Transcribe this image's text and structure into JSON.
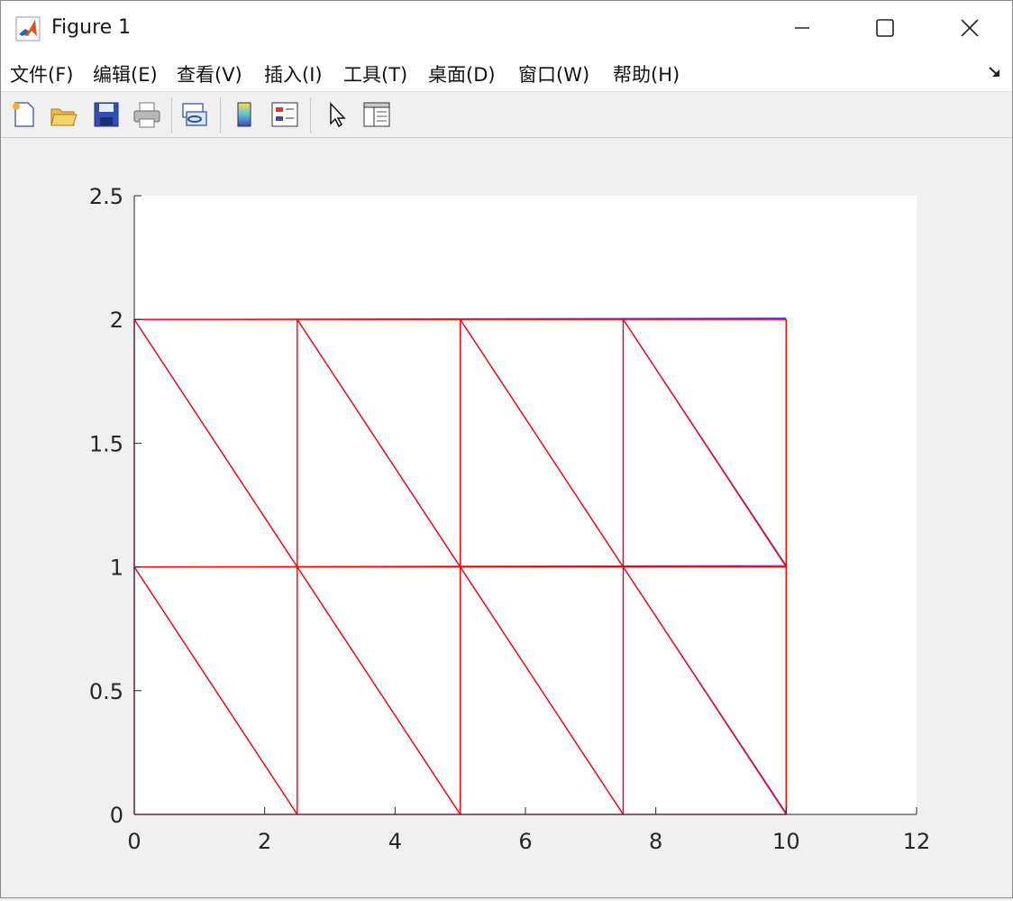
{
  "window": {
    "title": "Figure 1",
    "icon": "matlab-logo-icon",
    "controls": [
      "minimize-icon",
      "maximize-icon",
      "close-icon"
    ]
  },
  "menubar": {
    "items": [
      {
        "label": "文件(F)"
      },
      {
        "label": "编辑(E)"
      },
      {
        "label": "查看(V)"
      },
      {
        "label": "插入(I)"
      },
      {
        "label": "工具(T)"
      },
      {
        "label": "桌面(D)"
      },
      {
        "label": "窗口(W)"
      },
      {
        "label": "帮助(H)"
      }
    ],
    "dock_icon": "dock-arrow-icon"
  },
  "toolbar": {
    "buttons": [
      {
        "icon": "new-figure-icon"
      },
      {
        "icon": "open-folder-icon"
      },
      {
        "icon": "save-icon"
      },
      {
        "icon": "print-icon"
      },
      {
        "icon": "link-plot-icon"
      },
      {
        "icon": "colorbar-icon"
      },
      {
        "icon": "legend-icon"
      },
      {
        "icon": "pointer-icon"
      },
      {
        "icon": "property-inspector-icon"
      }
    ]
  },
  "chart_data": {
    "type": "line",
    "title": "",
    "xlabel": "",
    "ylabel": "",
    "xlim": [
      0,
      12
    ],
    "ylim": [
      0,
      2.5
    ],
    "xticks": [
      "0",
      "2",
      "4",
      "6",
      "8",
      "10",
      "12"
    ],
    "yticks": [
      "0",
      "0.5",
      "1",
      "1.5",
      "2",
      "2.5"
    ],
    "grid": false,
    "series": [
      {
        "color": "#3b3bff",
        "segments": [
          [
            [
              0,
              0
            ],
            [
              10,
              0
            ]
          ],
          [
            [
              0,
              1
            ],
            [
              10,
              1.005
            ]
          ],
          [
            [
              0,
              2
            ],
            [
              10,
              2.005
            ]
          ],
          [
            [
              0,
              0
            ],
            [
              0,
              2
            ]
          ],
          [
            [
              2.5,
              0
            ],
            [
              2.5,
              2
            ]
          ],
          [
            [
              5,
              0
            ],
            [
              5,
              2
            ]
          ],
          [
            [
              7.5,
              0
            ],
            [
              7.5,
              2
            ]
          ],
          [
            [
              10,
              0
            ],
            [
              10,
              2
            ]
          ],
          [
            [
              0,
              1
            ],
            [
              2.5,
              0
            ]
          ],
          [
            [
              2.5,
              1
            ],
            [
              5,
              0
            ]
          ],
          [
            [
              5,
              1
            ],
            [
              7.5,
              0
            ]
          ],
          [
            [
              7.5,
              1
            ],
            [
              10,
              0.005
            ]
          ],
          [
            [
              0,
              2
            ],
            [
              2.5,
              1
            ]
          ],
          [
            [
              2.5,
              2
            ],
            [
              5,
              1
            ]
          ],
          [
            [
              5,
              2
            ],
            [
              7.5,
              1
            ]
          ],
          [
            [
              7.5,
              2
            ],
            [
              10,
              1.005
            ]
          ]
        ]
      },
      {
        "color": "#ff0000",
        "segments": [
          [
            [
              0,
              0
            ],
            [
              10,
              0
            ]
          ],
          [
            [
              0,
              1
            ],
            [
              10,
              1
            ]
          ],
          [
            [
              0,
              2
            ],
            [
              10,
              2
            ]
          ],
          [
            [
              0,
              0
            ],
            [
              0,
              2
            ]
          ],
          [
            [
              2.5,
              0
            ],
            [
              2.5,
              2
            ]
          ],
          [
            [
              5,
              0
            ],
            [
              5,
              2
            ]
          ],
          [
            [
              7.5,
              0
            ],
            [
              7.5,
              2
            ]
          ],
          [
            [
              10,
              0
            ],
            [
              10,
              2
            ]
          ],
          [
            [
              0,
              1
            ],
            [
              2.5,
              0
            ]
          ],
          [
            [
              2.5,
              1
            ],
            [
              5,
              0
            ]
          ],
          [
            [
              5,
              1
            ],
            [
              7.5,
              0
            ]
          ],
          [
            [
              7.5,
              1
            ],
            [
              10,
              0
            ]
          ],
          [
            [
              0,
              2
            ],
            [
              2.5,
              1
            ]
          ],
          [
            [
              2.5,
              2
            ],
            [
              5,
              1
            ]
          ],
          [
            [
              5,
              2
            ],
            [
              7.5,
              1
            ]
          ],
          [
            [
              7.5,
              2
            ],
            [
              10,
              1
            ]
          ]
        ]
      }
    ]
  }
}
